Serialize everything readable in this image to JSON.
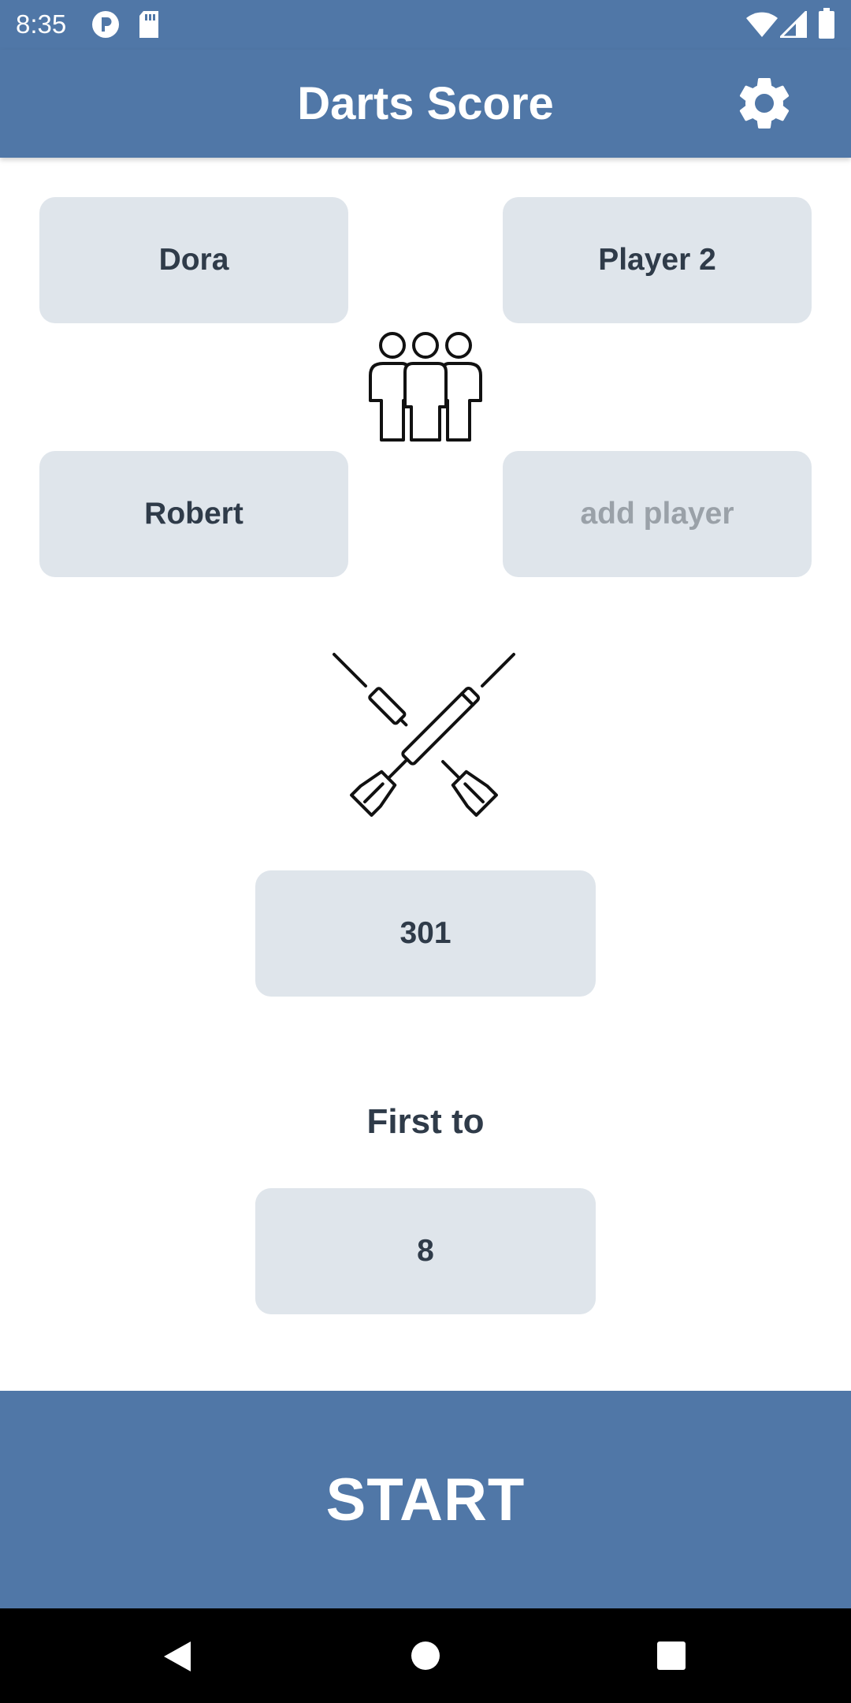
{
  "status_bar": {
    "time": "8:35",
    "left_icons": [
      "app-notification-icon",
      "sd-card-icon"
    ],
    "right_icons": [
      "wifi-icon",
      "signal-icon",
      "battery-icon"
    ]
  },
  "app_bar": {
    "title": "Darts Score",
    "settings_icon": "gear-icon"
  },
  "players": {
    "player_1": "Dora",
    "player_2": "Player 2",
    "player_3": "Robert",
    "add_player_placeholder": "add player"
  },
  "game": {
    "mode": "301",
    "first_to_label": "First to",
    "first_to_value": "8"
  },
  "start_label": "START",
  "nav_bar": {
    "buttons": [
      "back-icon",
      "home-icon",
      "recents-icon"
    ]
  },
  "colors": {
    "accent": "#5077a7",
    "tile": "#dfe5eb",
    "text_dark": "#2f3b49",
    "placeholder": "#9aa1a8"
  }
}
